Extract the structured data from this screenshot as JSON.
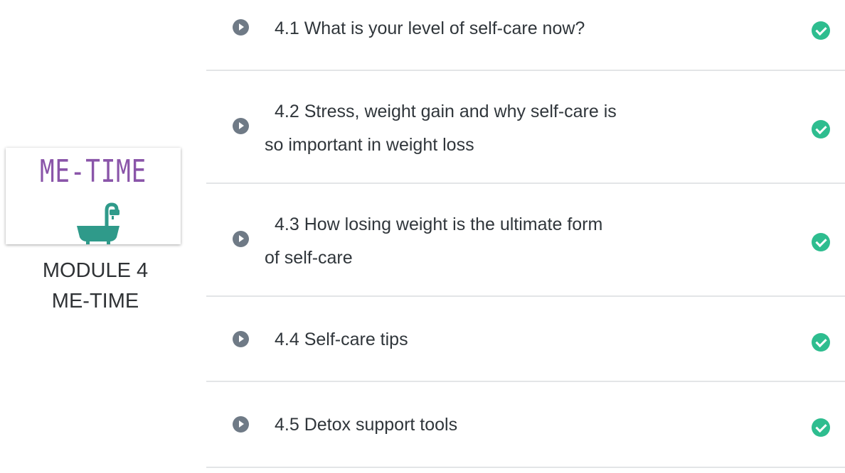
{
  "module": {
    "logo_text": "ME-TIME",
    "caption_line1": "MODULE 4",
    "caption_line2": "ME-TIME",
    "accent_color": "#8a55a9",
    "tub_color": "#2f9a8a"
  },
  "lessons": [
    {
      "title": "4.1 What is your level of self-care now?",
      "completed": true
    },
    {
      "title": "4.2 Stress, weight gain and why self-care is so important in weight loss",
      "completed": true
    },
    {
      "title": "4.3 How losing weight is the ultimate form of self-care",
      "completed": true
    },
    {
      "title": "4.4 Self-care tips",
      "completed": true
    },
    {
      "title": "4.5 Detox support tools",
      "completed": true
    }
  ],
  "colors": {
    "play_icon": "#6f7a86",
    "check_icon": "#2ebd8f",
    "divider": "#e3e5e7"
  },
  "icons": {
    "play": "play-circle-icon",
    "check": "check-circle-icon",
    "tub": "bathtub-icon"
  }
}
